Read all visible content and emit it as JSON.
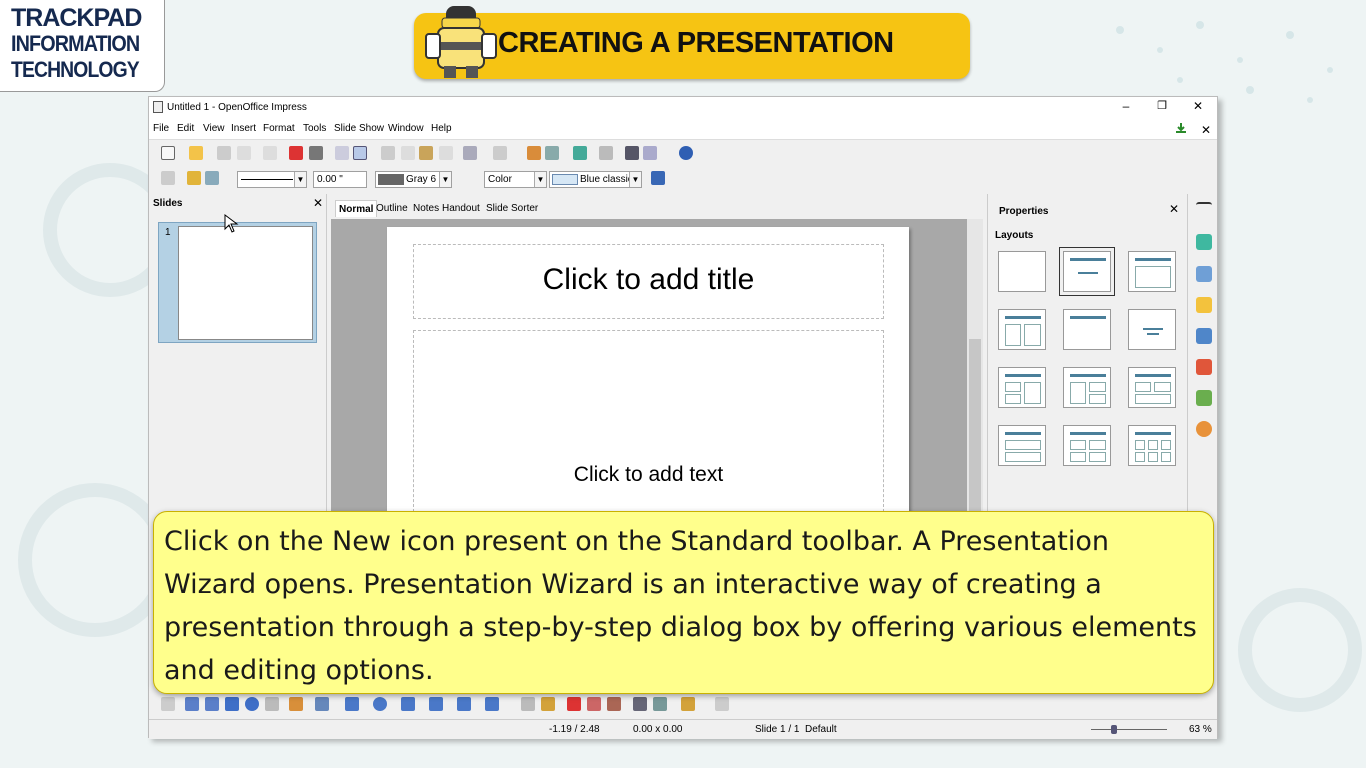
{
  "logo": {
    "line1": "TRACKPAD",
    "line2": "INFORMATION",
    "line3": "TECHNOLOGY"
  },
  "banner": {
    "title": "CREATING A PRESENTATION"
  },
  "window": {
    "title": "Untitled 1 - OpenOffice Impress",
    "controls": {
      "minimize": "–",
      "maximize": "❐",
      "close": "✕"
    },
    "doc_close": "✕"
  },
  "menu": [
    "File",
    "Edit",
    "View",
    "Insert",
    "Format",
    "Tools",
    "Slide Show",
    "Window",
    "Help"
  ],
  "line_toolbar": {
    "line_width": "0.00 \"",
    "area_color_name": "Gray 6",
    "area_style": "Color",
    "area_fill": "Blue classic"
  },
  "slides_pane": {
    "title": "Slides",
    "close": "✕",
    "slide_number": "1"
  },
  "view_tabs": [
    "Normal",
    "Outline",
    "Notes",
    "Handout",
    "Slide Sorter"
  ],
  "slide": {
    "title_placeholder": "Click to add title",
    "text_placeholder": "Click to add text"
  },
  "properties": {
    "title": "Properties",
    "close": "✕",
    "section": "Layouts"
  },
  "status": {
    "position": "-1.19 / 2.48",
    "size": "0.00 x 0.00",
    "slide": "Slide 1 / 1",
    "master": "Default",
    "zoom": "63 %"
  },
  "callout": {
    "text": "Click on the New icon present on the Standard toolbar. A Presentation Wizard opens. Presentation Wizard is an interactive way of creating a presentation through a step-by-step dialog box by offering various elements and editing options."
  },
  "colors": {
    "banner": "#f6c413",
    "callout": "#ffff8c",
    "logo_text": "#15294f",
    "layout_bar": "#4a7f9a"
  }
}
